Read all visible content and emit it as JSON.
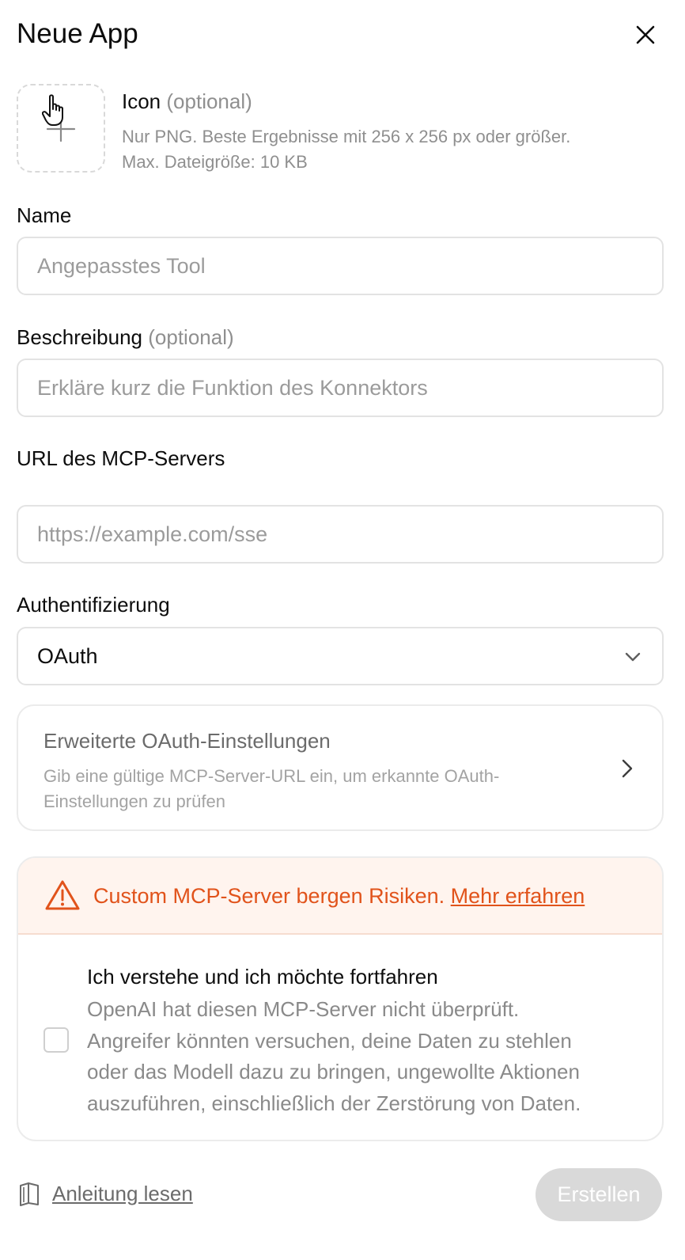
{
  "dialog": {
    "title": "Neue App"
  },
  "icon_upload": {
    "label": "Icon",
    "optional": "(optional)",
    "hint_line1": "Nur PNG. Beste Ergebnisse mit 256 x 256 px oder größer.",
    "hint_line2": "Max. Dateigröße: 10 KB"
  },
  "name_field": {
    "label": "Name",
    "placeholder": "Angepasstes Tool",
    "value": ""
  },
  "description_field": {
    "label": "Beschreibung",
    "optional": "(optional)",
    "placeholder": "Erkläre kurz die Funktion des Konnektors",
    "value": ""
  },
  "url_field": {
    "label": "URL des MCP-Servers",
    "placeholder": "https://example.com/sse",
    "value": ""
  },
  "auth_field": {
    "label": "Authentifizierung",
    "selected": "OAuth"
  },
  "oauth_settings": {
    "title": "Erweiterte OAuth-Einstellungen",
    "desc_line1": "Gib eine gültige MCP-Server-URL ein, um erkannte OAuth-",
    "desc_line2": "Einstellungen zu prüfen"
  },
  "risk": {
    "warning": "Custom MCP-Server bergen Risiken.",
    "link": "Mehr erfahren",
    "accent_color": "#e1531b",
    "consent_title": "Ich verstehe und ich möchte fortfahren",
    "consent_lines": [
      "OpenAI hat diesen MCP-Server nicht überprüft.",
      "Angreifer könnten versuchen, deine Daten zu stehlen",
      "oder das Modell dazu zu bringen, ungewollte Aktionen",
      "auszuführen, einschließlich der Zerstörung von Daten."
    ],
    "checked": false
  },
  "footer": {
    "guide_label": "Anleitung lesen",
    "create_label": "Erstellen"
  },
  "icons": {
    "close": "close-icon",
    "add_image": "plus-icon",
    "cursor": "hand-pointer-icon",
    "dropdown": "chevron-down-icon",
    "expand": "chevron-right-icon",
    "warning": "warning-triangle-icon",
    "guide": "book-icon"
  }
}
